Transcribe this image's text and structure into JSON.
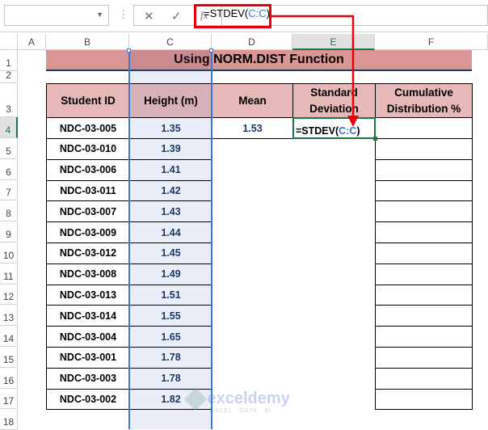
{
  "formula_bar": {
    "name_box": "",
    "cancel_icon": "✕",
    "enter_icon": "✓",
    "fx_label": "fx",
    "formula_prefix": "=STDEV(",
    "formula_ref": "C:C",
    "formula_suffix": ")"
  },
  "columns": [
    "A",
    "B",
    "C",
    "D",
    "E",
    "F"
  ],
  "rows": [
    "1",
    "2",
    "3",
    "4",
    "5",
    "6",
    "7",
    "8",
    "9",
    "10",
    "11",
    "12",
    "13",
    "14",
    "15",
    "16",
    "17",
    "18"
  ],
  "title": "Using NORM.DIST Function",
  "headers": {
    "id": "Student ID",
    "height": "Height (m)",
    "mean": "Mean",
    "sd_line1": "Standard",
    "sd_line2": "Deviation",
    "cd_line1": "Cumulative",
    "cd_line2": "Distribution %"
  },
  "mean_value": "1.53",
  "active_cell_prefix": "=STDEV(",
  "active_cell_ref": "C:C",
  "active_cell_suffix": ")",
  "students": [
    {
      "id": "NDC-03-005",
      "height": "1.35"
    },
    {
      "id": "NDC-03-010",
      "height": "1.39"
    },
    {
      "id": "NDC-03-006",
      "height": "1.41"
    },
    {
      "id": "NDC-03-011",
      "height": "1.42"
    },
    {
      "id": "NDC-03-007",
      "height": "1.43"
    },
    {
      "id": "NDC-03-009",
      "height": "1.44"
    },
    {
      "id": "NDC-03-012",
      "height": "1.45"
    },
    {
      "id": "NDC-03-008",
      "height": "1.49"
    },
    {
      "id": "NDC-03-013",
      "height": "1.51"
    },
    {
      "id": "NDC-03-014",
      "height": "1.55"
    },
    {
      "id": "NDC-03-004",
      "height": "1.65"
    },
    {
      "id": "NDC-03-001",
      "height": "1.78"
    },
    {
      "id": "NDC-03-003",
      "height": "1.78"
    },
    {
      "id": "NDC-03-002",
      "height": "1.82"
    }
  ],
  "watermark": {
    "name": "exceldemy",
    "tagline": "EXCEL · DATA · BI"
  },
  "colors": {
    "accent_red": "#e8000b",
    "header_fill": "#e6b8b7",
    "title_fill": "#da9694",
    "selection_blue": "#3a78d4",
    "active_green": "#217346"
  }
}
